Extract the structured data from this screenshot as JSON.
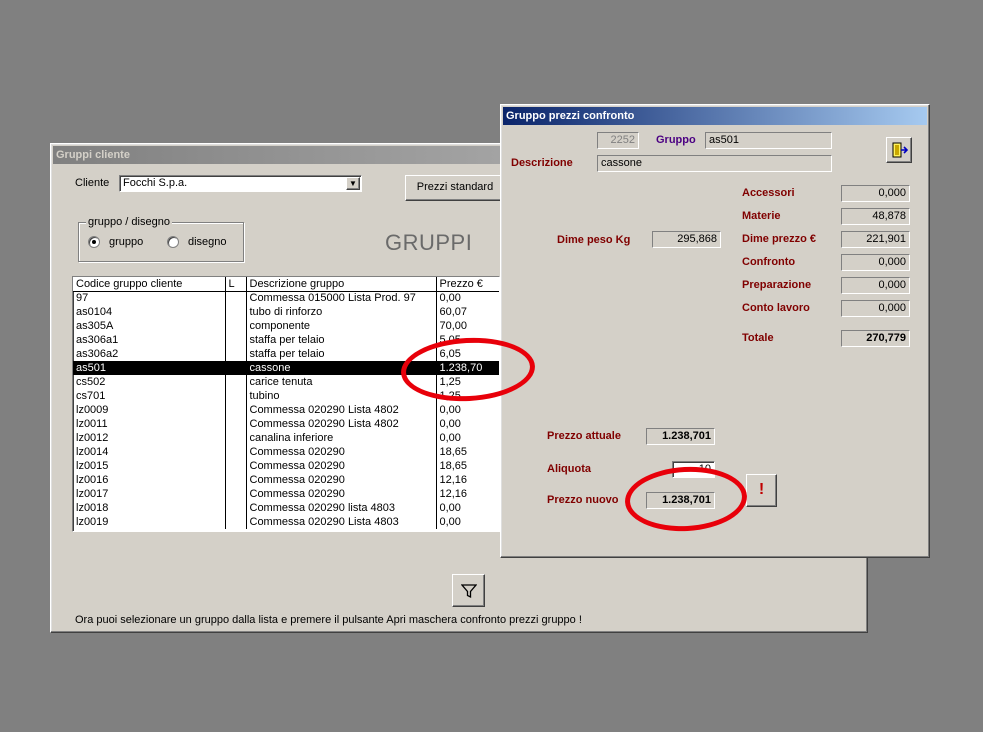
{
  "gruppi_window": {
    "title": "Gruppi cliente",
    "cliente_label": "Cliente",
    "cliente_value": "Focchi S.p.a.",
    "prezzi_standard_button": "Prezzi standard",
    "radio_group_title": "gruppo / disegno",
    "radio_gruppo": "gruppo",
    "radio_disegno": "disegno",
    "selected_radio": "gruppo",
    "heading": "GRUPPI",
    "columns": [
      "Codice gruppo cliente",
      "L",
      "Descrizione gruppo",
      "Prezzo €"
    ],
    "rows": [
      {
        "codice": "97",
        "l": "",
        "descrizione": "Commessa 015000 Lista Prod. 97",
        "prezzo": "0,00"
      },
      {
        "codice": "as0104",
        "l": "",
        "descrizione": "tubo di rinforzo",
        "prezzo": "60,07"
      },
      {
        "codice": "as305A",
        "l": "",
        "descrizione": "componente",
        "prezzo": "70,00"
      },
      {
        "codice": "as306a1",
        "l": "",
        "descrizione": "staffa per telaio",
        "prezzo": "5,05"
      },
      {
        "codice": "as306a2",
        "l": "",
        "descrizione": "staffa per telaio",
        "prezzo": "6,05"
      },
      {
        "codice": "as501",
        "l": "",
        "descrizione": "cassone",
        "prezzo": "1.238,70"
      },
      {
        "codice": "cs502",
        "l": "",
        "descrizione": "carice tenuta",
        "prezzo": "1,25"
      },
      {
        "codice": "cs701",
        "l": "",
        "descrizione": "tubino",
        "prezzo": "1,25"
      },
      {
        "codice": "lz0009",
        "l": "",
        "descrizione": "Commessa 020290 Lista 4802",
        "prezzo": "0,00"
      },
      {
        "codice": "lz0011",
        "l": "",
        "descrizione": "Commessa 020290 Lista 4802",
        "prezzo": "0,00"
      },
      {
        "codice": "lz0012",
        "l": "",
        "descrizione": "canalina inferiore",
        "prezzo": "0,00"
      },
      {
        "codice": "lz0014",
        "l": "",
        "descrizione": "Commessa 020290",
        "prezzo": "18,65"
      },
      {
        "codice": "lz0015",
        "l": "",
        "descrizione": "Commessa 020290",
        "prezzo": "18,65"
      },
      {
        "codice": "lz0016",
        "l": "",
        "descrizione": "Commessa 020290",
        "prezzo": "12,16"
      },
      {
        "codice": "lz0017",
        "l": "",
        "descrizione": "Commessa 020290",
        "prezzo": "12,16"
      },
      {
        "codice": "lz0018",
        "l": "",
        "descrizione": "Commessa 020290 lista 4803",
        "prezzo": "0,00"
      },
      {
        "codice": "lz0019",
        "l": "",
        "descrizione": "Commessa 020290 Lista 4803",
        "prezzo": "0,00"
      }
    ],
    "selected_row_code": "as501",
    "filter_icon": "filter-funnel-icon",
    "status_message": "Ora puoi selezionare un gruppo dalla lista e premere il pulsante Apri maschera confronto prezzi gruppo !"
  },
  "confronto_window": {
    "title": "Gruppo prezzi confronto",
    "id_value": "2252",
    "gruppo_label": "Gruppo",
    "gruppo_value": "as501",
    "descrizione_label": "Descrizione",
    "descrizione_value": "cassone",
    "exit_icon": "exit-door-icon",
    "dime_peso_label": "Dime peso Kg",
    "dime_peso_value": "295,868",
    "costs": [
      {
        "label": "Accessori",
        "value": "0,000"
      },
      {
        "label": "Materie",
        "value": "48,878"
      },
      {
        "label": "Dime prezzo €",
        "value": "221,901"
      },
      {
        "label": "Confronto",
        "value": "0,000"
      },
      {
        "label": "Preparazione",
        "value": "0,000"
      },
      {
        "label": "Conto lavoro",
        "value": "0,000"
      }
    ],
    "totale_label": "Totale",
    "totale_value": "270,779",
    "prezzo_attuale_label": "Prezzo attuale",
    "prezzo_attuale_value": "1.238,701",
    "aliquota_label": "Aliquota",
    "aliquota_value": "10",
    "prezzo_nuovo_label": "Prezzo nuovo",
    "prezzo_nuovo_value": "1.238,701",
    "action_icon": "exclamation-icon"
  },
  "colors": {
    "highlight_circle": "#e8000a",
    "label_red": "#800000",
    "label_purple": "#4b0082",
    "window_bg": "#d4d0c8",
    "desktop": "#808080"
  }
}
